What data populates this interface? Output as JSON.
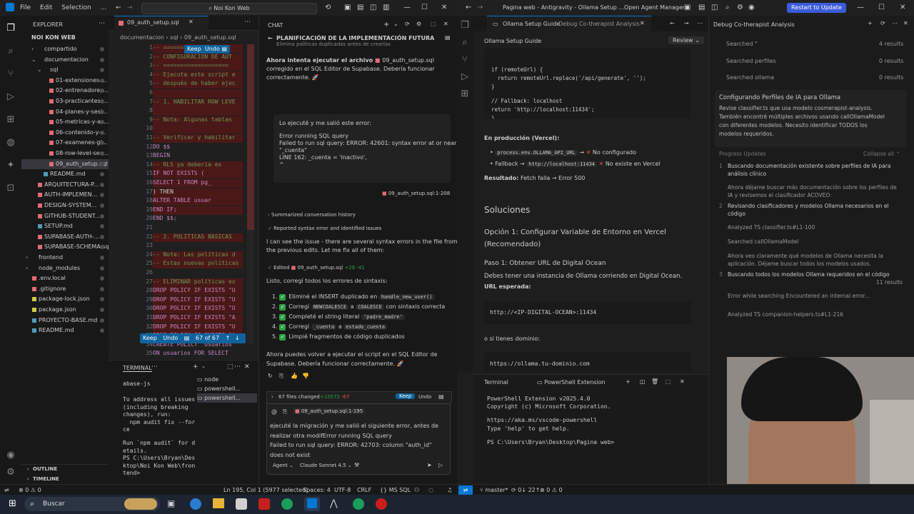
{
  "titlebar": {
    "menu": [
      "File",
      "Edit",
      "Selection",
      "..."
    ],
    "search": "Noi Kon Web",
    "right_title": "Pagina web - Antigravity - Ollama Setup ...",
    "open_agent": "Open Agent Manager",
    "restart": "Restart to Update"
  },
  "explorer": {
    "header": "EXPLORER",
    "root": "NOI KON WEB",
    "items": [
      {
        "label": "compartido",
        "indent": 1,
        "arrow": "›"
      },
      {
        "label": "documentacion",
        "indent": 1,
        "arrow": "⌄"
      },
      {
        "label": "sql",
        "indent": 2,
        "arrow": "⌄"
      },
      {
        "label": "01-extensiones-...",
        "indent": 3,
        "arrow": ""
      },
      {
        "label": "02-entrenadores...",
        "indent": 3,
        "arrow": ""
      },
      {
        "label": "03-practicantes-...",
        "indent": 3,
        "arrow": ""
      },
      {
        "label": "04-planes-y-sesi...",
        "indent": 3,
        "arrow": ""
      },
      {
        "label": "05-metricas-y-as...",
        "indent": 3,
        "arrow": ""
      },
      {
        "label": "06-contenido-y-...",
        "indent": 3,
        "arrow": ""
      },
      {
        "label": "07-examenes-gl...",
        "indent": 3,
        "arrow": ""
      },
      {
        "label": "08-row-level-sec...",
        "indent": 3,
        "arrow": ""
      },
      {
        "label": "09_auth_setup.sql",
        "indent": 3,
        "arrow": "",
        "selected": true
      },
      {
        "label": "README.md",
        "indent": 2,
        "arrow": ""
      },
      {
        "label": "ARQUITECTURA-P...",
        "indent": 1,
        "arrow": ""
      },
      {
        "label": "AUTH-IMPLEMEN...",
        "indent": 1,
        "arrow": ""
      },
      {
        "label": "DESIGN-SYSTEM...",
        "indent": 1,
        "arrow": ""
      },
      {
        "label": "GITHUB-STUDENT...",
        "indent": 1,
        "arrow": ""
      },
      {
        "label": "SETUP.md",
        "indent": 1,
        "arrow": ""
      },
      {
        "label": "SUPABASE-AUTH-...",
        "indent": 1,
        "arrow": ""
      },
      {
        "label": "SUPABASE-SCHEMA.sql",
        "indent": 1,
        "arrow": ""
      },
      {
        "label": "frontend",
        "indent": 0,
        "arrow": "›"
      },
      {
        "label": "node_modules",
        "indent": 0,
        "arrow": "›"
      },
      {
        "label": ".env.local",
        "indent": 0,
        "arrow": ""
      },
      {
        "label": ".gitignore",
        "indent": 0,
        "arrow": ""
      },
      {
        "label": "package-lock.json",
        "indent": 0,
        "arrow": ""
      },
      {
        "label": "package.json",
        "indent": 0,
        "arrow": ""
      },
      {
        "label": "PROYECTO-BASE.md",
        "indent": 0,
        "arrow": ""
      },
      {
        "label": "README.md",
        "indent": 0,
        "arrow": ""
      }
    ],
    "outline": "OUTLINE",
    "timeline": "TIMELINE"
  },
  "editor": {
    "tab": "09_auth_setup.sql",
    "breadcrumb": [
      "documentacion",
      "sql",
      "09_auth_setup.sql"
    ],
    "keep": "Keep",
    "undo": "Undo",
    "counter": "67 of 67",
    "lines": [
      {
        "n": "1",
        "t": "-- ===================",
        "del": true
      },
      {
        "n": "2",
        "t": "-- CONFIGURACIÓN DE AUT",
        "del": true
      },
      {
        "n": "3",
        "t": "-- ===================",
        "del": true
      },
      {
        "n": "4",
        "t": "-- Ejecuta este script e",
        "del": true
      },
      {
        "n": "5",
        "t": "-- después de haber ejec",
        "del": true
      },
      {
        "n": "6",
        "t": "",
        "del": true
      },
      {
        "n": "7",
        "t": "-- 1. HABILITAR ROW LEVE",
        "del": true
      },
      {
        "n": "8",
        "t": "",
        "del": true
      },
      {
        "n": "9",
        "t": "-- Nota: Algunas tablas",
        "del": true
      },
      {
        "n": "10",
        "t": "",
        "del": true
      },
      {
        "n": "11",
        "t": "-- Verificar y habilitar",
        "del": true
      },
      {
        "n": "12",
        "t": "DO $$",
        "del": false
      },
      {
        "n": "13",
        "t": "BEGIN",
        "del": false
      },
      {
        "n": "14",
        "t": "    -- RLS ya debería es",
        "del": true
      },
      {
        "n": "15",
        "t": "    IF NOT EXISTS (",
        "del": true
      },
      {
        "n": "16",
        "t": "        SELECT 1 FROM pg_",
        "del": true
      },
      {
        "n": "17",
        "t": "    ) THEN",
        "del": true
      },
      {
        "n": "18",
        "t": "        ALTER TABLE usuar",
        "del": true
      },
      {
        "n": "19",
        "t": "    END IF;",
        "del": true
      },
      {
        "n": "20",
        "t": "END $$;",
        "del": false
      },
      {
        "n": "21",
        "t": "",
        "del": false
      },
      {
        "n": "22",
        "t": "-- 2. POLÍTICAS BÁSICAS",
        "del": true
      },
      {
        "n": "23",
        "t": "",
        "del": false
      },
      {
        "n": "24",
        "t": "-- Nota: Las políticas d",
        "del": true
      },
      {
        "n": "25",
        "t": "-- Estas nuevas políticas",
        "del": true
      },
      {
        "n": "26",
        "t": "",
        "del": false
      },
      {
        "n": "27",
        "t": "-- ELIMINAR políticas ex",
        "del": true
      },
      {
        "n": "28",
        "t": "DROP POLICY IF EXISTS \"U",
        "del": true
      },
      {
        "n": "29",
        "t": "DROP POLICY IF EXISTS \"U",
        "del": true
      },
      {
        "n": "30",
        "t": "DROP POLICY IF EXISTS \"U",
        "del": true
      },
      {
        "n": "31",
        "t": "DROP POLICY IF EXISTS \"A",
        "del": true
      },
      {
        "n": "32",
        "t": "DROP POLICY IF EXISTS \"U",
        "del": true
      },
      {
        "n": "33",
        "t": "DROP POLICY IF EXISTS \"A",
        "del": true
      },
      {
        "n": "34",
        "t": "CREATE POLICY \"Usuarios",
        "del": false
      },
      {
        "n": "35",
        "t": "ON usuarios FOR SELECT",
        "del": false
      }
    ]
  },
  "chat": {
    "tab": "CHAT",
    "title": "PLANIFICACIÓN DE LA IMPLEMENTACIÓN FUTURA",
    "top_line": "Elimina políticas duplicadas antes de crearlas",
    "msg1_a": "Ahora intenta ejecutar el archivo",
    "msg1_file": "09_auth_setup.sql",
    "msg1_b": "corregido en el SQL Editor de Supabase. Debería funcionar",
    "msg1_c": "correctamente. 🚀",
    "user_msg": [
      "Lo ejecuté y me salió este error:",
      "",
      "Error running SQL query",
      "Failed to run sql query: ERROR: 42601: syntax error at or near",
      "\"_cuenta\"",
      "LINE 162: _cuenta = 'inactivo',",
      "^"
    ],
    "user_ref": "09_auth_setup.sql:1-208",
    "summary": "Summarized conversation history",
    "reported": "Reported syntax error and identified issues",
    "intro": [
      "I can see the issue - there are several syntax errors in the file from",
      "the previous edits. Let me fix all of them:"
    ],
    "edited": "Edited",
    "edited_file": "09_auth_setup.sql",
    "edited_stats": "+28 -41",
    "fixed": "Listo, corregí todos los errores de sintaxis:",
    "fixes": [
      {
        "a": "Eliminé el INSERT duplicado en",
        "code": "handle_new_user()",
        "b": ""
      },
      {
        "a": "Corregí",
        "code": "NEWCOALESCE",
        "b": "a",
        "code2": "COALESCE",
        "c": "con sintaxis correcta"
      },
      {
        "a": "Completé el string literal",
        "code": "'padre_madre'",
        "b": ""
      },
      {
        "a": "Corregí",
        "code": "_cuenta",
        "b": "a",
        "code2": "estado_cuenta",
        "c": ""
      },
      {
        "a": "Limpié fragmentos de código duplicados",
        "code": "",
        "b": ""
      }
    ],
    "closing": [
      "Ahora puedes volver a ejecutar el script en el SQL Editor de",
      "Supabase. Debería funcionar correctamente. 🚀"
    ],
    "files_changed": "67 files changed",
    "files_add": "+10572",
    "files_del": "-67",
    "keep": "Keep",
    "undo": "Undo",
    "input_file": "09_auth_setup.sql:1-195",
    "input_text": [
      "ejecuté la migración y me salió el siguiente error, antes de",
      "realizar otra modifError running SQL query",
      "Failed to run sql query: ERROR: 42703: column \"auth_id\"",
      "does not exist"
    ],
    "agent": "Agent",
    "model": "Claude Sonnet 4.5"
  },
  "terminal": {
    "tab": "TERMINAL",
    "top": "abase-js",
    "lines": [
      "To address all issues",
      "(including breaking",
      "changes), run:",
      "  npm audit fix --for",
      "ce",
      "",
      "Run `npm audit` for d",
      "etails.",
      "PS C:\\Users\\Bryan\\Des",
      "ktop\\Noi Kon Web\\fron",
      "tend> "
    ],
    "sessions": [
      "node",
      "powershell...",
      "powershell..."
    ]
  },
  "right": {
    "tab1": "Ollama Setup Guide",
    "tab1b": "Debug Co-therapist Analysis",
    "doc_title": "Ollama Setup Guide",
    "review": "Review",
    "code_lines": [
      "if (remoteUrl) {",
      "  return remoteUrl.replace('/api/generate', '');",
      "}",
      "",
      "// Fallback: localhost",
      "return 'http://localhost:11434';",
      "}"
    ],
    "prod_heading": "En producción (Vercel):",
    "prod_items": [
      {
        "code": "process.env.OLLAMA_API_URL",
        "arrow": "→",
        "mark": "✕",
        "text": "No configurado"
      },
      {
        "code": "http://localhost:11434",
        "pre": "Fallback →",
        "mark": "✕",
        "text": "No existe en Vercel"
      }
    ],
    "result_label": "Resultado:",
    "result_text": "Fetch falla → Error 500",
    "solutions": "Soluciones",
    "option1": "Opción 1: Configurar Variable de Entorno en Vercel",
    "option1b": "(Recomendado)",
    "step1": "Paso 1: Obtener URL de Digital Ocean",
    "step1_text": "Debes tener una instancia de Ollama corriendo en Digital Ocean.",
    "url_label": "URL esperada:",
    "url1": "http://<IP-DIGITAL-OCEAN>:11434",
    "or_domain": "o si tienes dominio:",
    "url2": "https://ollama.tu-dominio.com",
    "terminal_tab": "Terminal",
    "ps_ext": "PowerShell Extension",
    "ps_lines": [
      "PowerShell Extension v2025.4.0",
      "Copyright (c) Microsoft Corporation.",
      "",
      "https://aka.ms/vscode-powershell",
      "Type 'help' to get help.",
      "",
      "PS C:\\Users\\Bryan\\Desktop\\Pagina web> "
    ],
    "agent_title": "Debug Co-therapist Analysis",
    "searched": [
      {
        "label": "Searched \"",
        "count": "4 results"
      },
      {
        "label": "Searched perfiles",
        "count": "0 results"
      },
      {
        "label": "Searched ollama",
        "count": "0 results"
      }
    ],
    "config_title": "Configurando Perfiles de IA para Ollama",
    "config_text": [
      "Revise classifier.ts que usa modelo cosmerapist-analysis.",
      "También encontré múltiples archivos usando callOllamaModel",
      "con diferentes modelos. Necesito identificar TODOS los",
      "modelos requeridos."
    ],
    "progress": "Progress Updates",
    "collapse": "Collapse all",
    "steps": [
      {
        "n": "1",
        "t": "Buscando documentación existente sobre perfiles de IA para análisis clínico"
      },
      {
        "n": "",
        "t": "Ahora déjame buscar más documentación sobre los perfiles de IA y revisemos el clasificador ACOVEO:"
      },
      {
        "n": "2",
        "t": "Revisando clasificadores y modelos Ollama necesarios en el código"
      },
      {
        "n": "",
        "t": "Analyzed  TS classifier.ts#L1-100"
      },
      {
        "n": "",
        "t": "Searched  callOllamaModel"
      },
      {
        "n": "",
        "t": "Ahora veo claramente qué modelos de Ollama necesita la aplicación. Déjame buscar todos los modelos usados."
      },
      {
        "n": "3",
        "t": "Buscando todos los modelos Ollama requeridos en el código"
      },
      {
        "n": "",
        "t": "Error while searching  Encountered an internal error..."
      },
      {
        "n": "",
        "t": "Analyzed  TS companion-helpers.ts#L1-216"
      }
    ],
    "searched_calls": "11 results"
  },
  "status": {
    "left": "⊗ 0 ⚠ 0",
    "pos": "Ln 195, Col 1 (5977 selected)",
    "spaces": "Spaces: 4",
    "enc": "UTF-8",
    "eol": "CRLF",
    "lang": "MS SQL",
    "branch": "master*",
    "sync": "0↓ 22↑",
    "errs": "⊗ 0 ⚠ 0"
  },
  "taskbar": {
    "search": "Buscar"
  },
  "colors": {
    "accent": "#0e639c",
    "green": "#2ea043",
    "red": "#f14c4c",
    "restart": "#3b5bdb"
  }
}
